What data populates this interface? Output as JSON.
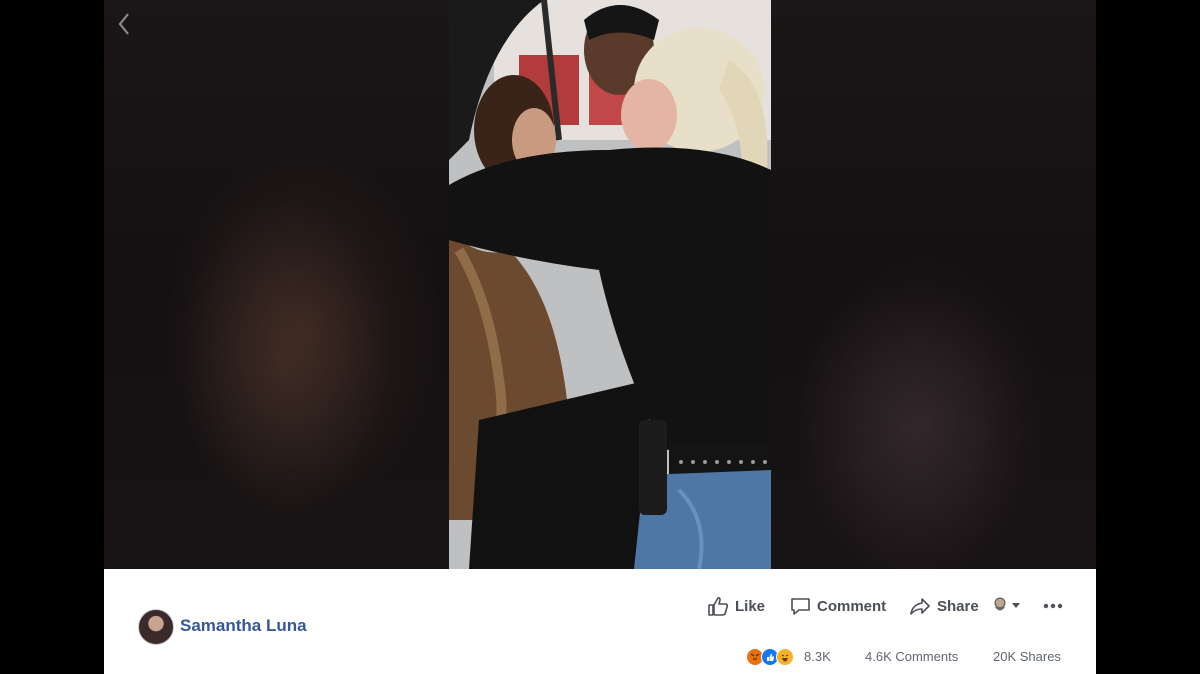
{
  "viewer": {
    "back_icon": "chevron-left-icon"
  },
  "post": {
    "author": "Samantha Luna",
    "avatar_icon": "avatar"
  },
  "actions": {
    "like": "Like",
    "comment": "Comment",
    "share": "Share",
    "audience_icon": "audience-selector-icon",
    "more_icon": "more-options-icon"
  },
  "stats": {
    "reaction_count": "8.3K",
    "comments": "4.6K Comments",
    "shares": "20K Shares",
    "reaction_icons": [
      "angry-reaction-icon",
      "like-reaction-icon",
      "haha-reaction-icon"
    ]
  },
  "colors": {
    "author_link": "#365899",
    "action_text": "#4b4f56",
    "like_blue": "#1877f2",
    "angry": "#e9710f",
    "haha": "#f7b125"
  }
}
